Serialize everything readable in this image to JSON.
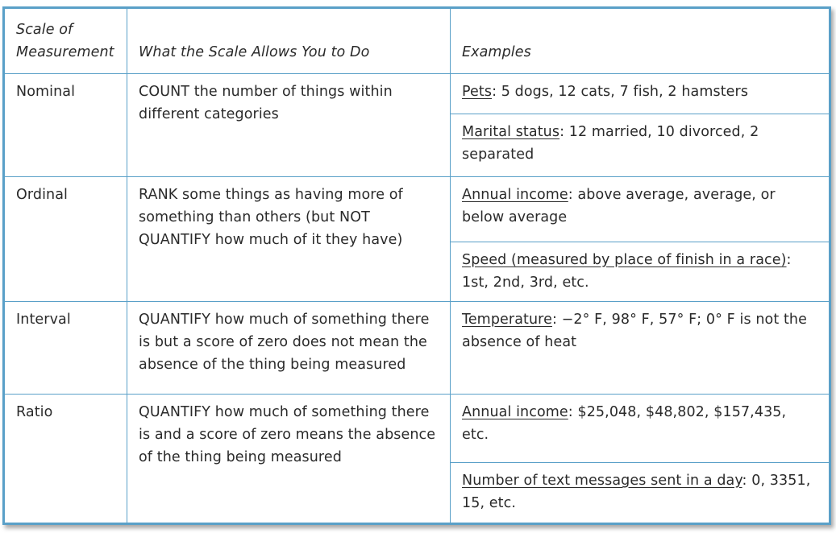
{
  "headers": {
    "col1": "Scale of Measurement",
    "col1_line1": "Scale of",
    "col1_line2": "Measurement",
    "col2": "What the Scale Allows You to Do",
    "col3": "Examples"
  },
  "rows": [
    {
      "scale": "Nominal",
      "allows": "COUNT the number of things within different categories",
      "examples": [
        {
          "label": "Pets",
          "text": ": 5 dogs, 12 cats, 7 fish, 2 hamsters"
        },
        {
          "label": "Marital status",
          "text": ": 12 married, 10 divorced, 2 separated"
        }
      ]
    },
    {
      "scale": "Ordinal",
      "allows": "RANK some things as having more of something than others (but NOT QUANTIFY how much of it they have)",
      "examples": [
        {
          "label": "Annual income",
          "text": ": above average, average, or below average"
        },
        {
          "label": "Speed (measured by place of finish in a race)",
          "text": ": 1st, 2nd, 3rd, etc."
        }
      ]
    },
    {
      "scale": "Interval",
      "allows": "QUANTIFY how much of something there is but a score of zero does not mean the absence of the thing being measured",
      "examples": [
        {
          "label": "Temperature",
          "text": ": −2° F, 98° F, 57° F; 0° F is not the absence of heat"
        }
      ]
    },
    {
      "scale": "Ratio",
      "allows": "QUANTIFY how much of something there is and a score of zero means the absence of the thing being measured",
      "examples": [
        {
          "label": "Annual income",
          "text": ": $25,048, $48,802, $157,435, etc."
        },
        {
          "label": "Number of text messages sent in a day",
          "text": ": 0, 3351, 15, etc."
        }
      ]
    }
  ],
  "colors": {
    "border": "#5aa0c8",
    "text": "#2a2a2a"
  }
}
